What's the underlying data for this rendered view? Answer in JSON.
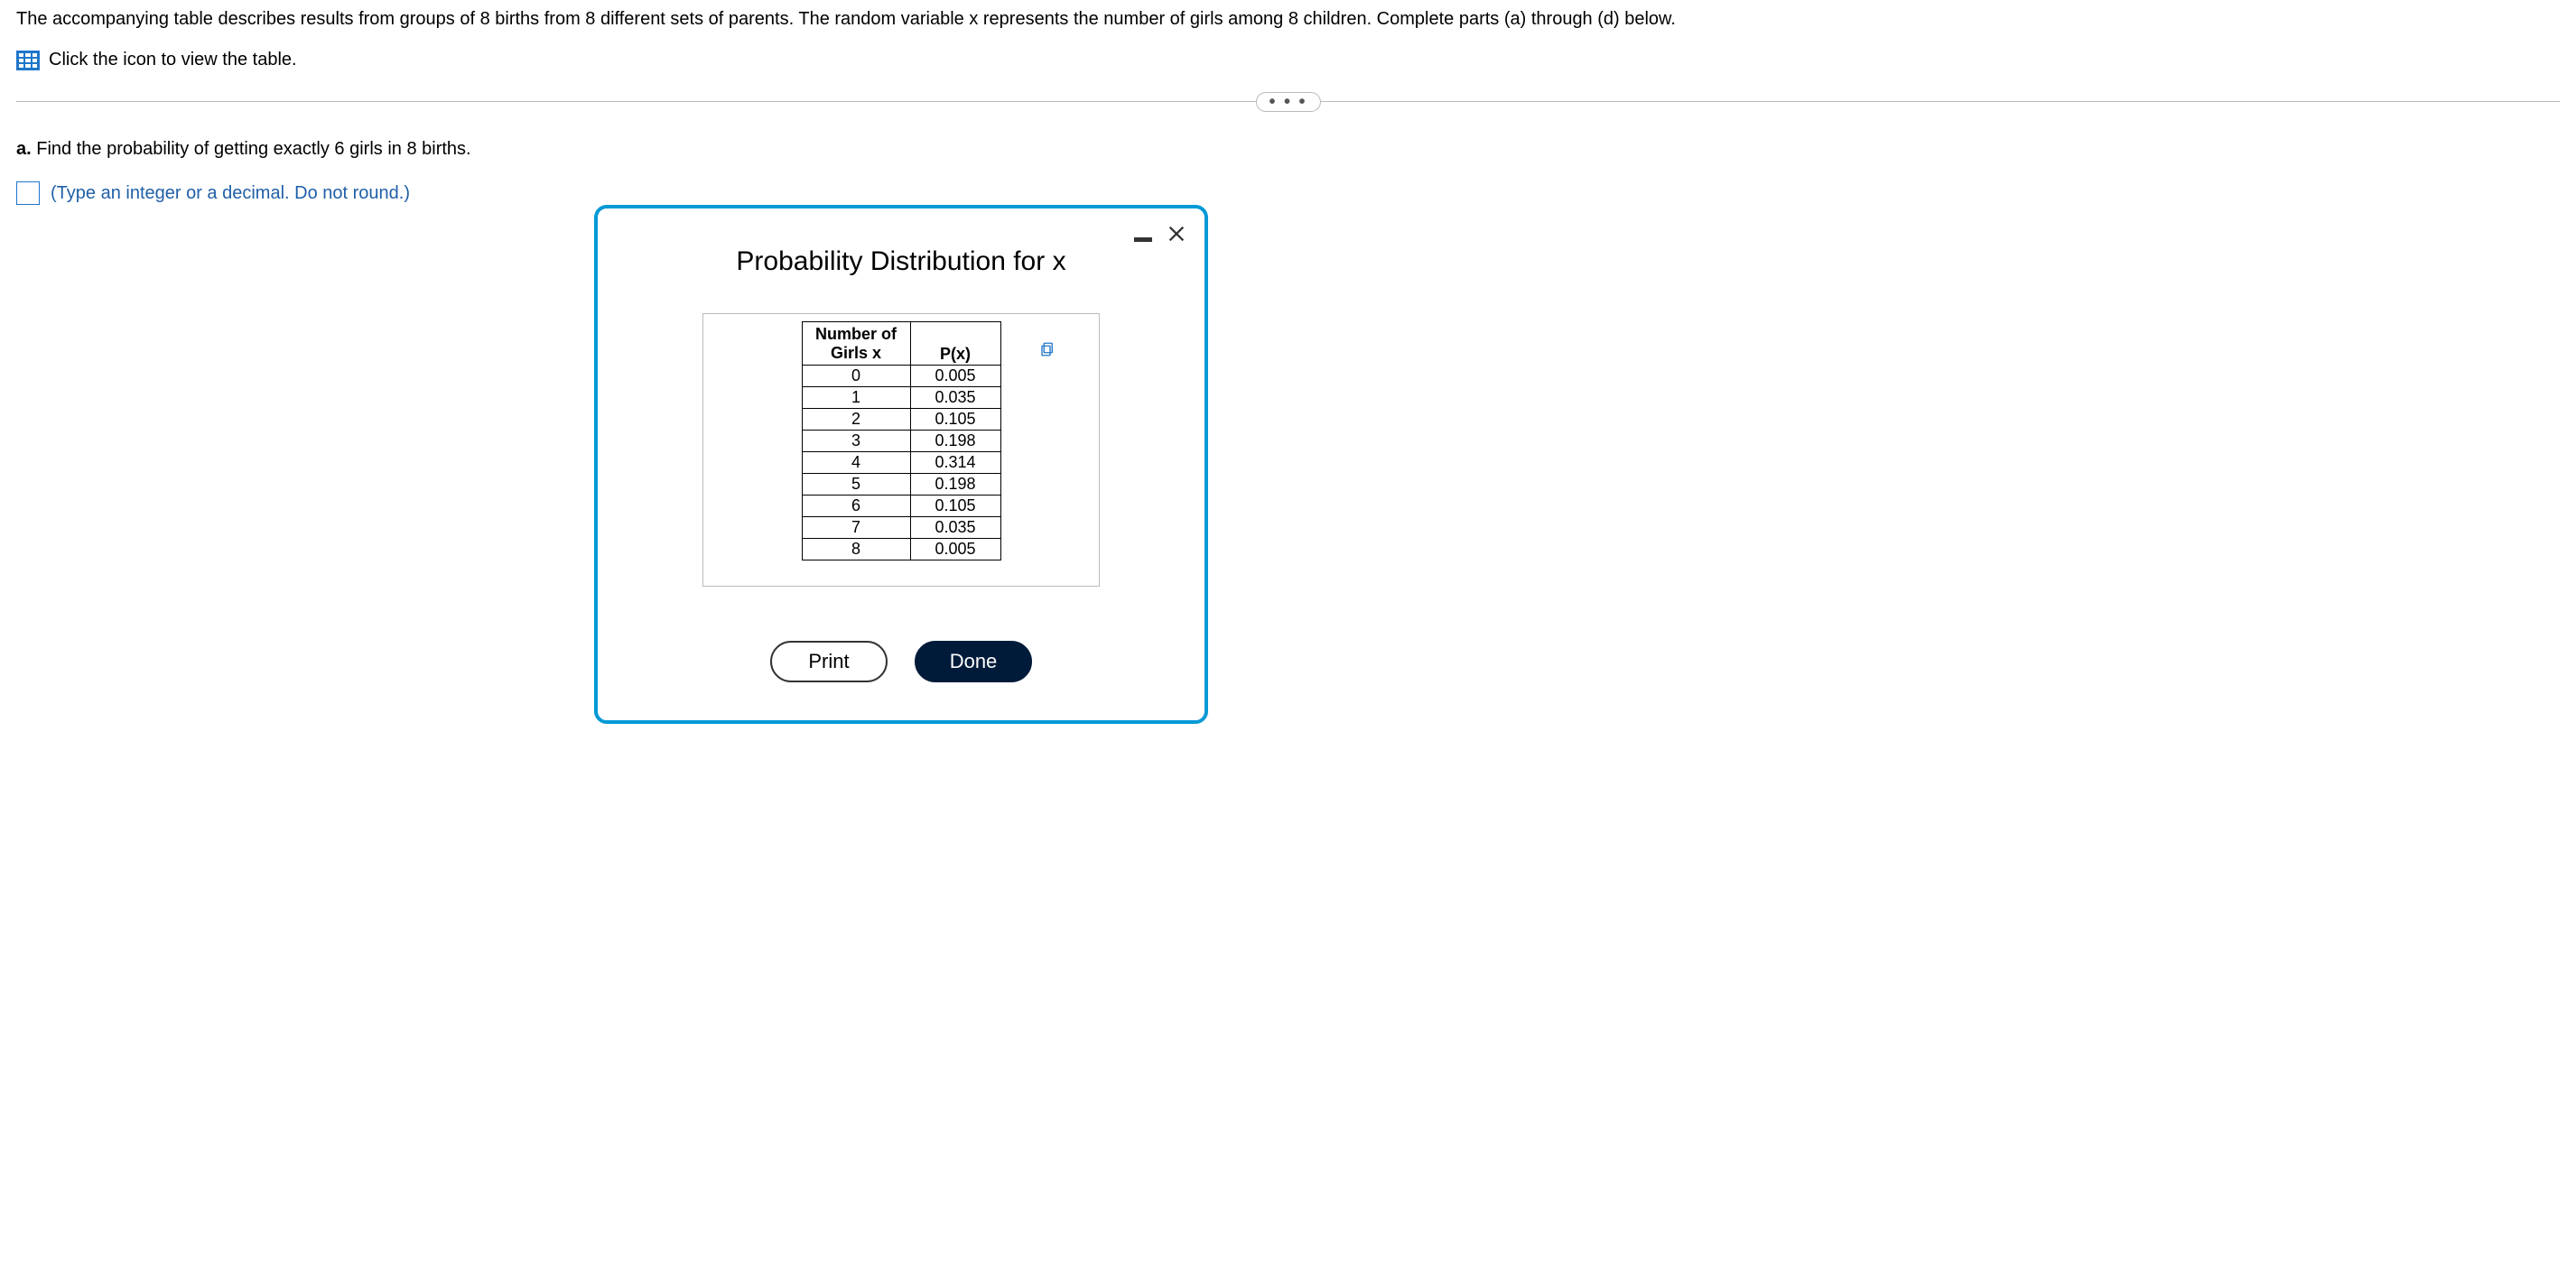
{
  "question": {
    "intro": "The accompanying table describes results from groups of 8 births from 8 different sets of parents. The random variable x represents the number of girls among 8 children. Complete parts (a) through (d) below.",
    "link_text": "Click the icon to view the table.",
    "part_a_label": "a.",
    "part_a_text": " Find the probability of getting exactly 6 girls in 8 births.",
    "instruction": "(Type an integer or a decimal. Do not round.)",
    "answer_value": ""
  },
  "divider": {
    "dots": "• • •"
  },
  "dialog": {
    "title": "Probability Distribution for x",
    "print_label": "Print",
    "done_label": "Done",
    "table": {
      "header_x_line1": "Number of",
      "header_x_line2": "Girls x",
      "header_px": "P(x)",
      "rows": [
        {
          "x": "0",
          "p": "0.005"
        },
        {
          "x": "1",
          "p": "0.035"
        },
        {
          "x": "2",
          "p": "0.105"
        },
        {
          "x": "3",
          "p": "0.198"
        },
        {
          "x": "4",
          "p": "0.314"
        },
        {
          "x": "5",
          "p": "0.198"
        },
        {
          "x": "6",
          "p": "0.105"
        },
        {
          "x": "7",
          "p": "0.035"
        },
        {
          "x": "8",
          "p": "0.005"
        }
      ]
    }
  }
}
